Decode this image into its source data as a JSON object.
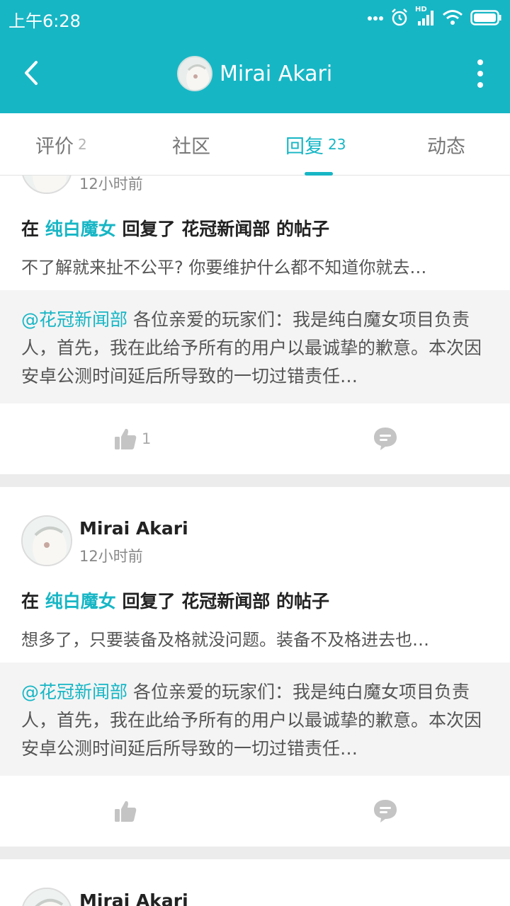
{
  "status_bar": {
    "time": "上午6:28",
    "hd_label": "HD"
  },
  "header": {
    "title": "Mirai Akari"
  },
  "tabs": [
    {
      "label": "评价",
      "count": "2",
      "active": false
    },
    {
      "label": "社区",
      "count": "",
      "active": false
    },
    {
      "label": "回复",
      "count": "23",
      "active": true
    },
    {
      "label": "动态",
      "count": "",
      "active": false
    }
  ],
  "posts": [
    {
      "user": "",
      "time": "12小时前",
      "action_prefix": "在",
      "game": "纯白魔女",
      "action_mid": "回复了",
      "target": "花冠新闻部",
      "action_suffix": "的帖子",
      "reply": "不了解就来扯不公平? 你要维护什么都不知道你就去…",
      "quote_mention": "@花冠新闻部",
      "quote_text": "各位亲爱的玩家们：我是纯白魔女项目负责人，首先，我在此给予所有的用户以最诚挚的歉意。本次因安卓公测时间延后所导致的一切过错责任…",
      "likes": "1"
    },
    {
      "user": "Mirai Akari",
      "time": "12小时前",
      "action_prefix": "在",
      "game": "纯白魔女",
      "action_mid": "回复了",
      "target": "花冠新闻部",
      "action_suffix": "的帖子",
      "reply": "想多了，只要装备及格就没问题。装备不及格进去也…",
      "quote_mention": "@花冠新闻部",
      "quote_text": "各位亲爱的玩家们：我是纯白魔女项目负责人，首先，我在此给予所有的用户以最诚挚的歉意。本次因安卓公测时间延后所导致的一切过错责任…",
      "likes": ""
    },
    {
      "user": "Mirai Akari"
    }
  ],
  "colors": {
    "accent": "#17b6c5",
    "quote_bg": "#f4f4f4",
    "divider": "#ececec"
  }
}
